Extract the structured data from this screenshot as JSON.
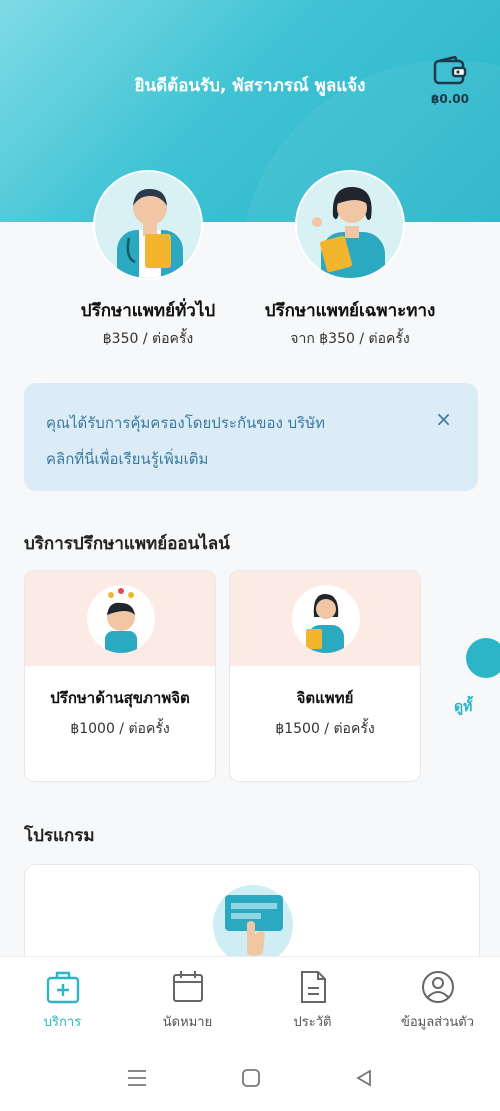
{
  "header": {
    "greeting": "ยินดีต้อนรับ, พัสราภรณ์ พูลแจ้ง",
    "wallet_amount": "฿0.00"
  },
  "doctors": [
    {
      "title": "ปรึกษาแพทย์ทั่วไป",
      "price": "฿350 / ต่อครั้ง"
    },
    {
      "title": "ปรึกษาแพทย์เฉพาะทาง",
      "price": "จาก ฿350 / ต่อครั้ง"
    }
  ],
  "notice": {
    "line1": "คุณได้รับการคุ้มครองโดยประกันของ บริษัท",
    "line2": "คลิกที่นี่เพื่อเรียนรู้เพิ่มเติม",
    "close": "×"
  },
  "online_section": {
    "title": "บริการปรึกษาแพทย์ออนไลน์",
    "cards": [
      {
        "name": "ปรึกษาด้านสุขภาพจิต",
        "price": "฿1000 / ต่อครั้ง"
      },
      {
        "name": "จิตแพทย์",
        "price": "฿1500 / ต่อครั้ง"
      }
    ],
    "see_all": "ดูทั้"
  },
  "program_section": {
    "title": "โปรแกรม"
  },
  "tabbar": {
    "items": [
      {
        "label": "บริการ",
        "icon": "medical-kit-icon",
        "active": true
      },
      {
        "label": "นัดหมาย",
        "icon": "calendar-icon",
        "active": false
      },
      {
        "label": "ประวัติ",
        "icon": "document-icon",
        "active": false
      },
      {
        "label": "ข้อมูลส่วนตัว",
        "icon": "user-icon",
        "active": false
      }
    ]
  },
  "colors": {
    "accent": "#2bb5c6",
    "notice_text": "#3b79a0",
    "notice_bg": "#dcecf6"
  }
}
